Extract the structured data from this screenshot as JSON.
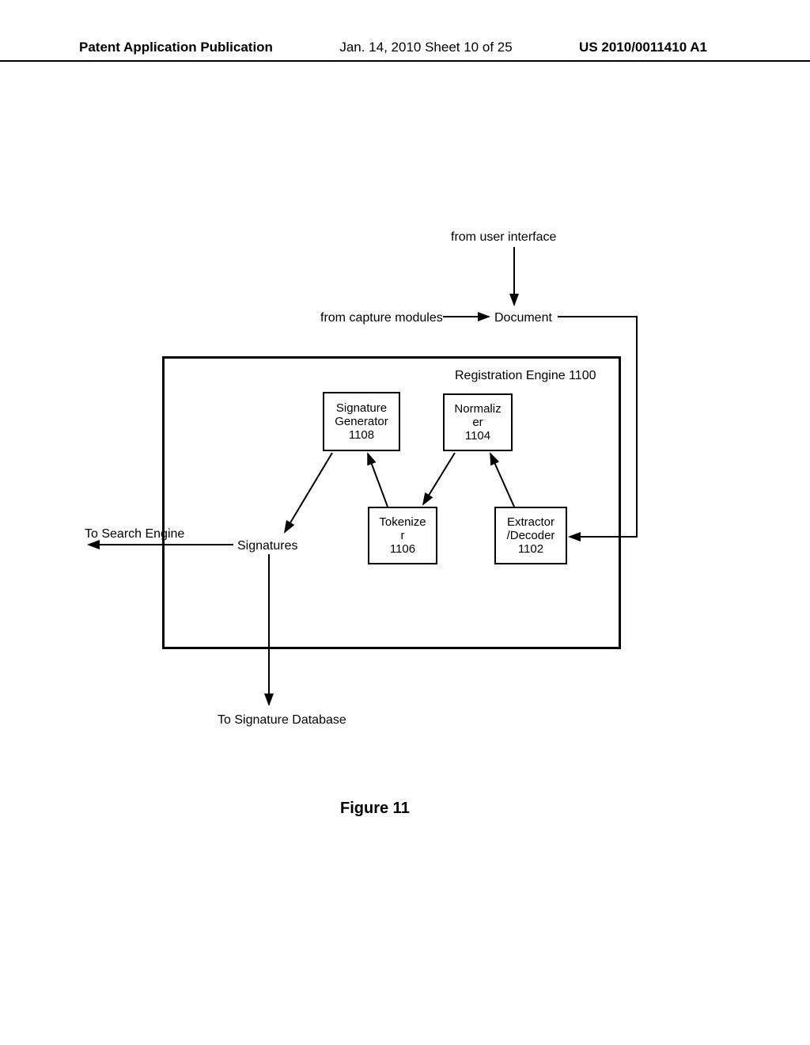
{
  "header": {
    "left": "Patent Application Publication",
    "mid": "Jan. 14, 2010   Sheet 10 of 25",
    "right": "US 2010/0011410 A1"
  },
  "labels": {
    "from_ui": "from user interface",
    "from_capture": "from capture modules",
    "document": "Document",
    "engine_title": "Registration Engine 1100",
    "sig_gen_l1": "Signature",
    "sig_gen_l2": "Generator",
    "sig_gen_l3": "1108",
    "norm_l1": "Normaliz",
    "norm_l2": "er",
    "norm_l3": "1104",
    "tok_l1": "Tokenize",
    "tok_l2": "r",
    "tok_l3": "1106",
    "ext_l1": "Extractor",
    "ext_l2": "/Decoder",
    "ext_l3": "1102",
    "signatures": "Signatures",
    "to_search": "To Search Engine",
    "to_sigdb": "To Signature Database",
    "figure": "Figure 11"
  },
  "chart_data": {
    "type": "diagram",
    "title": "Figure 11",
    "nodes": [
      {
        "id": "document",
        "label": "Document"
      },
      {
        "id": "registration_engine",
        "label": "Registration Engine 1100",
        "children": [
          "sig_gen",
          "normalizer",
          "tokenizer",
          "extractor"
        ]
      },
      {
        "id": "sig_gen",
        "label": "Signature Generator 1108"
      },
      {
        "id": "normalizer",
        "label": "Normalizer 1104"
      },
      {
        "id": "tokenizer",
        "label": "Tokenizer 1106"
      },
      {
        "id": "extractor",
        "label": "Extractor/Decoder 1102"
      },
      {
        "id": "signatures",
        "label": "Signatures"
      }
    ],
    "edges": [
      {
        "from": "from user interface",
        "to": "document"
      },
      {
        "from": "from capture modules",
        "to": "document"
      },
      {
        "from": "document",
        "to": "extractor"
      },
      {
        "from": "extractor",
        "to": "normalizer"
      },
      {
        "from": "normalizer",
        "to": "tokenizer"
      },
      {
        "from": "tokenizer",
        "to": "sig_gen"
      },
      {
        "from": "sig_gen",
        "to": "signatures"
      },
      {
        "from": "signatures",
        "to": "To Search Engine"
      },
      {
        "from": "signatures",
        "to": "To Signature Database"
      }
    ]
  }
}
